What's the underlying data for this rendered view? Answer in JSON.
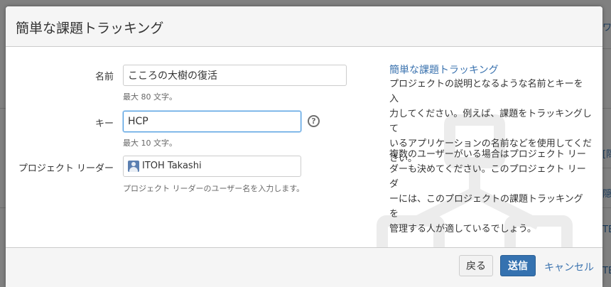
{
  "dialog": {
    "title": "簡単な課題トラッキング"
  },
  "form": {
    "name": {
      "label": "名前",
      "value": "こころの大樹の復活",
      "hint": "最大 80 文字。"
    },
    "key": {
      "label": "キー",
      "value": "HCP",
      "hint": "最大 10 文字。",
      "help_icon": "?"
    },
    "lead": {
      "label": "プロジェクト リーダー",
      "value": "ITOH Takashi",
      "hint": "プロジェクト リーダーのユーザー名を入力します。"
    }
  },
  "sidebar": {
    "title": "簡単な課題トラッキング",
    "paragraph1": [
      "プロジェクトの説明となるような名前とキーを入",
      "力してください。例えば、課題をトラッキングして",
      "いるアプリケーションの名前などを使用してくだ",
      "さい。"
    ],
    "paragraph2": [
      "複数のユーザーがいる場合はプロジェクト リー",
      "ダーも決めてください。このプロジェクト リーダ",
      "ーには、このプロジェクトの課題トラッキングを",
      "管理する人が適しているでしょう。"
    ]
  },
  "footer": {
    "back_label": "戻る",
    "submit_label": "送信",
    "cancel_label": "キャンセル"
  },
  "backdrop": {
    "fragments": [
      "ワ",
      "[隠",
      "隠",
      "TE",
      "TE"
    ]
  },
  "colors": {
    "link": "#3b73af",
    "primary_button": "#3572b0",
    "focus_border": "#4a9ae0"
  }
}
